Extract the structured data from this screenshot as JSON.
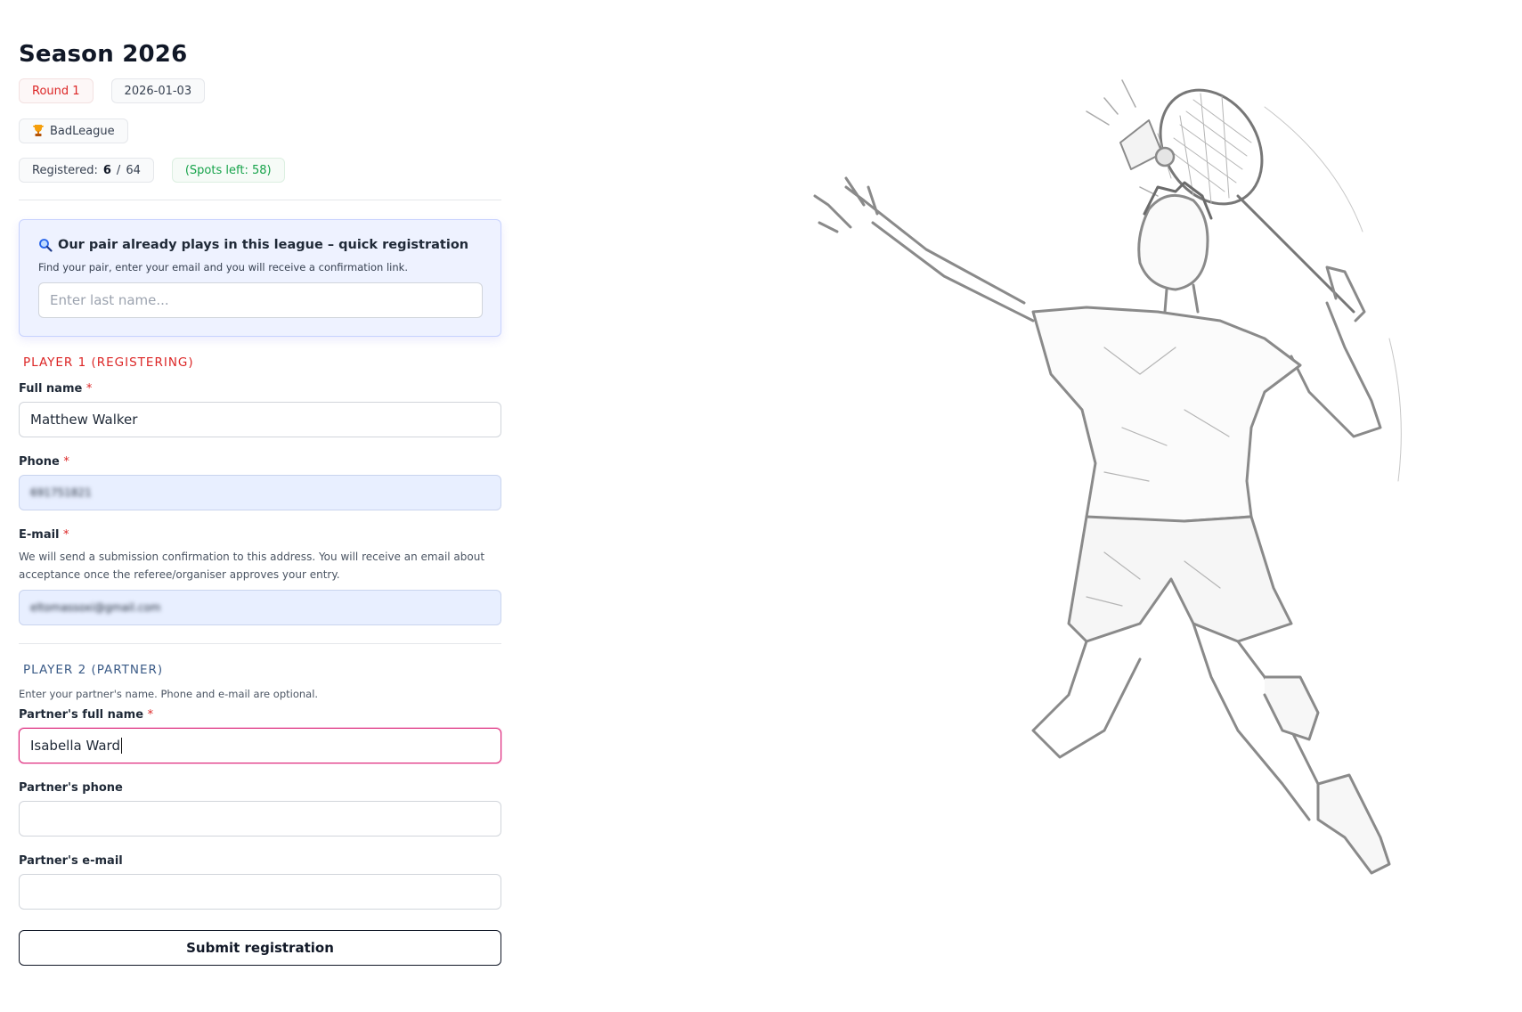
{
  "header": {
    "title": "Season 2026",
    "round": "Round 1",
    "date": "2026-01-03",
    "league": "BadLeague",
    "league_icon": "trophy-icon",
    "registered_label": "Registered:",
    "registered_count": "6",
    "registered_sep": "/",
    "registered_total": "64",
    "spots_left": "(Spots left: 58)"
  },
  "quick": {
    "icon": "magnifier-icon",
    "title": "Our pair already plays in this league – quick registration",
    "subtitle": "Find your pair, enter your email and you will receive a confirmation link.",
    "placeholder": "Enter last name..."
  },
  "player1": {
    "heading": "PLAYER 1 (REGISTERING)",
    "name_label": "Full name",
    "name_value": "Matthew Walker",
    "phone_label": "Phone",
    "phone_value": "691751821",
    "email_label": "E-mail",
    "email_help": "We will send a submission confirmation to this address. You will receive an email about acceptance once the referee/organiser approves your entry.",
    "email_value": "eltomassoxi@gmail.com",
    "required_mark": "*"
  },
  "player2": {
    "heading": "PLAYER 2 (PARTNER)",
    "help": "Enter your partner's name. Phone and e-mail are optional.",
    "name_label": "Partner's full name",
    "name_value": "Isabella Ward",
    "phone_label": "Partner's phone",
    "email_label": "Partner's e-mail"
  },
  "submit_label": "Submit registration",
  "colors": {
    "accent_red": "#dc2626",
    "accent_green": "#16a34a",
    "quick_bg": "#eef2ff",
    "focus_border": "#db2777"
  }
}
